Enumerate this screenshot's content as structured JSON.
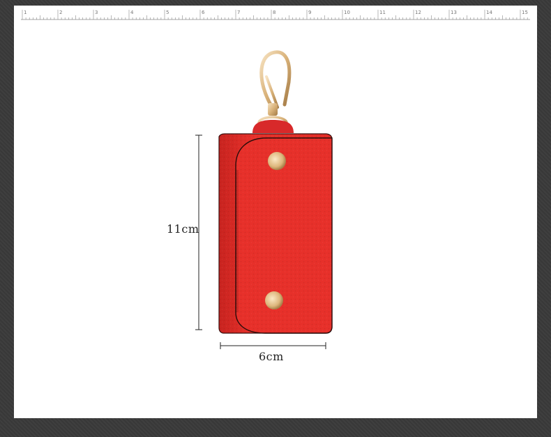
{
  "ruler": {
    "marks": [
      "1",
      "2",
      "3",
      "4",
      "5",
      "6",
      "7",
      "8",
      "9",
      "10",
      "11",
      "12",
      "13",
      "14",
      "15"
    ]
  },
  "product": {
    "name_icon": "key-case-icon",
    "leather_color": "#e8312b",
    "hardware_color": "#d9b27a"
  },
  "dimensions": {
    "height": "11cm",
    "width": "6cm"
  }
}
